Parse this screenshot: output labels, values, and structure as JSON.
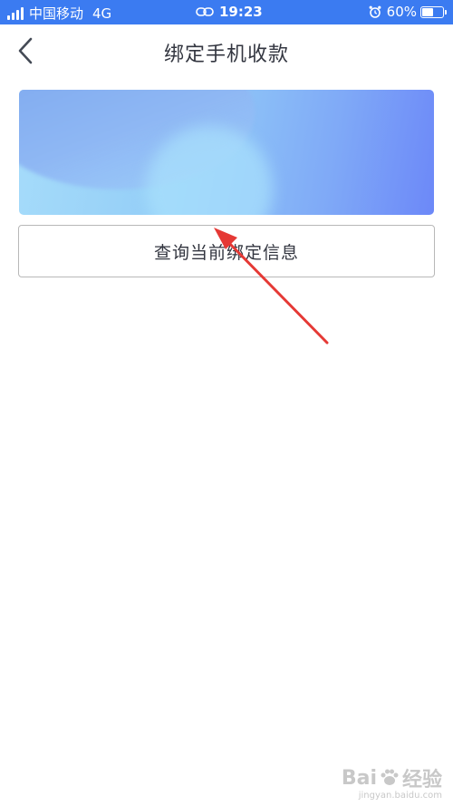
{
  "status_bar": {
    "carrier": "中国移动",
    "network": "4G",
    "time": "19:23",
    "battery_percent": "60%",
    "battery_level": 0.6,
    "icons": [
      "signal-icon",
      "link-icon",
      "alarm-icon",
      "battery-icon"
    ]
  },
  "nav": {
    "title": "绑定手机收款",
    "back_icon": "back-chevron-icon"
  },
  "card": {
    "name": "",
    "number": "",
    "colors": {
      "start": "#a6dcfa",
      "end": "#6c88f8"
    }
  },
  "query_button": {
    "label": "查询当前绑定信息"
  },
  "annotation": {
    "type": "red-arrow",
    "color": "#e53935"
  },
  "watermark": {
    "logo_text_1": "Bai",
    "logo_text_2": "经验",
    "url": "jingyan.baidu.com"
  },
  "theme": {
    "status_bar_bg": "#3b7bf1",
    "text_color": "#333640"
  }
}
